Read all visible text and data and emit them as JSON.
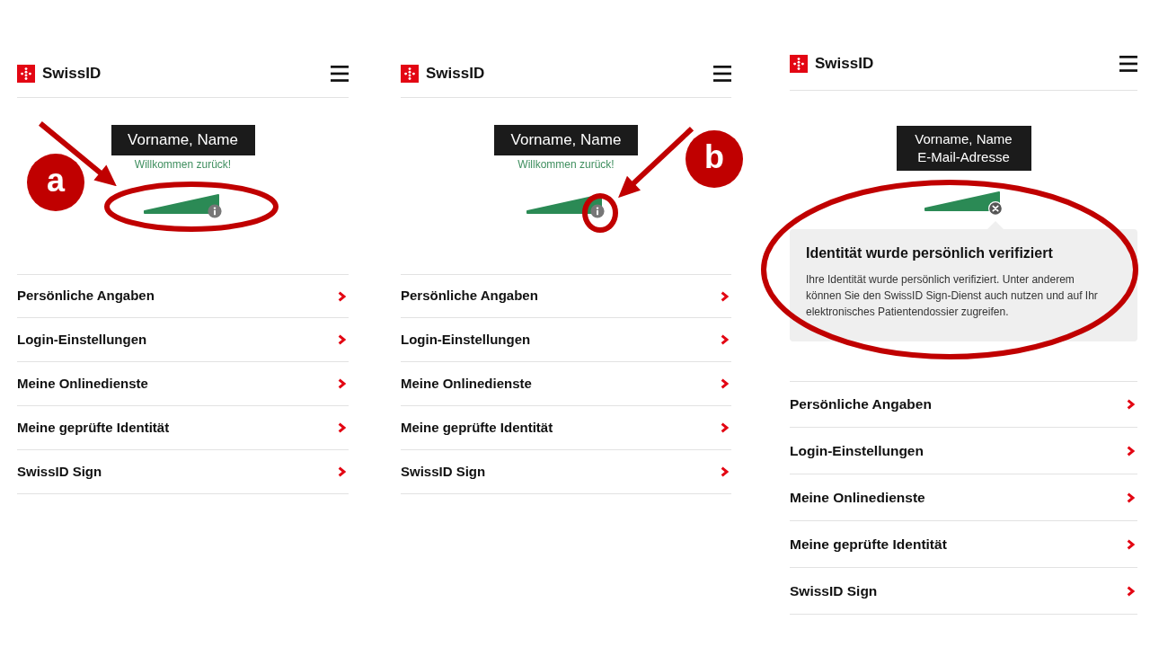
{
  "panels": [
    {
      "header": {
        "brand": "SwissID"
      },
      "profile": {
        "name": "Vorname, Name",
        "greeting": "Willkommen zurück!"
      },
      "meter": {
        "highlighted": true,
        "callout": "a",
        "info_button": {
          "expanded": false
        }
      },
      "menu": [
        "Persönliche Angaben",
        "Login-Einstellungen",
        "Meine Onlinedienste",
        "Meine geprüfte Identität",
        "SwissID Sign"
      ]
    },
    {
      "header": {
        "brand": "SwissID"
      },
      "profile": {
        "name": "Vorname, Name",
        "greeting": "Willkommen zurück!"
      },
      "meter": {
        "info_button": {
          "expanded": false,
          "highlighted": true,
          "callout": "b"
        }
      },
      "menu": [
        "Persönliche Angaben",
        "Login-Einstellungen",
        "Meine Onlinedienste",
        "Meine geprüfte Identität",
        "SwissID Sign"
      ]
    },
    {
      "header": {
        "brand": "SwissID"
      },
      "profile": {
        "name": "Vorname, Name",
        "email": "E-Mail-Adresse"
      },
      "meter": {
        "info_button": {
          "expanded": true
        }
      },
      "tooltip": {
        "title": "Identität wurde persönlich verifiziert",
        "text": "Ihre Identität wurde persönlich verifiziert. Unter anderem können Sie den SwissID Sign-Dienst auch nutzen und auf Ihr elektronisches Patientendossier zugreifen.",
        "highlighted": true
      },
      "menu": [
        "Persönliche Angaben",
        "Login-Einstellungen",
        "Meine Onlinedienste",
        "Meine geprüfte Identität",
        "SwissID Sign"
      ]
    }
  ]
}
